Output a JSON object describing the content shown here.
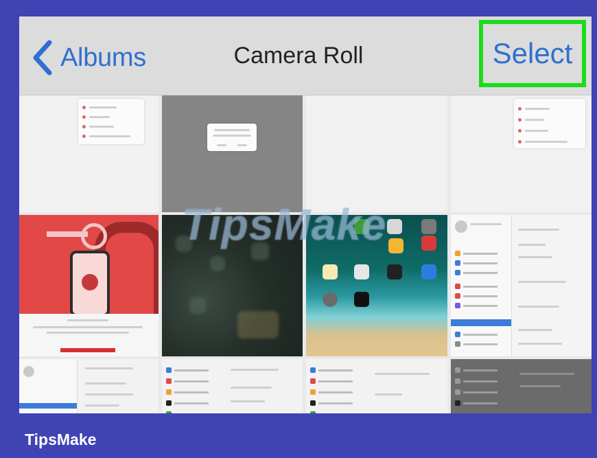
{
  "navbar": {
    "back_label": "Albums",
    "title": "Camera Roll",
    "select_label": "Select",
    "accent_color": "#2f6fd1",
    "highlight_color": "#1bdc1b"
  },
  "watermark": "TipsMake",
  "footer": {
    "brand": "TipsMake",
    "background": "#3f43b4"
  },
  "icons": [
    "chevron-left-icon"
  ]
}
